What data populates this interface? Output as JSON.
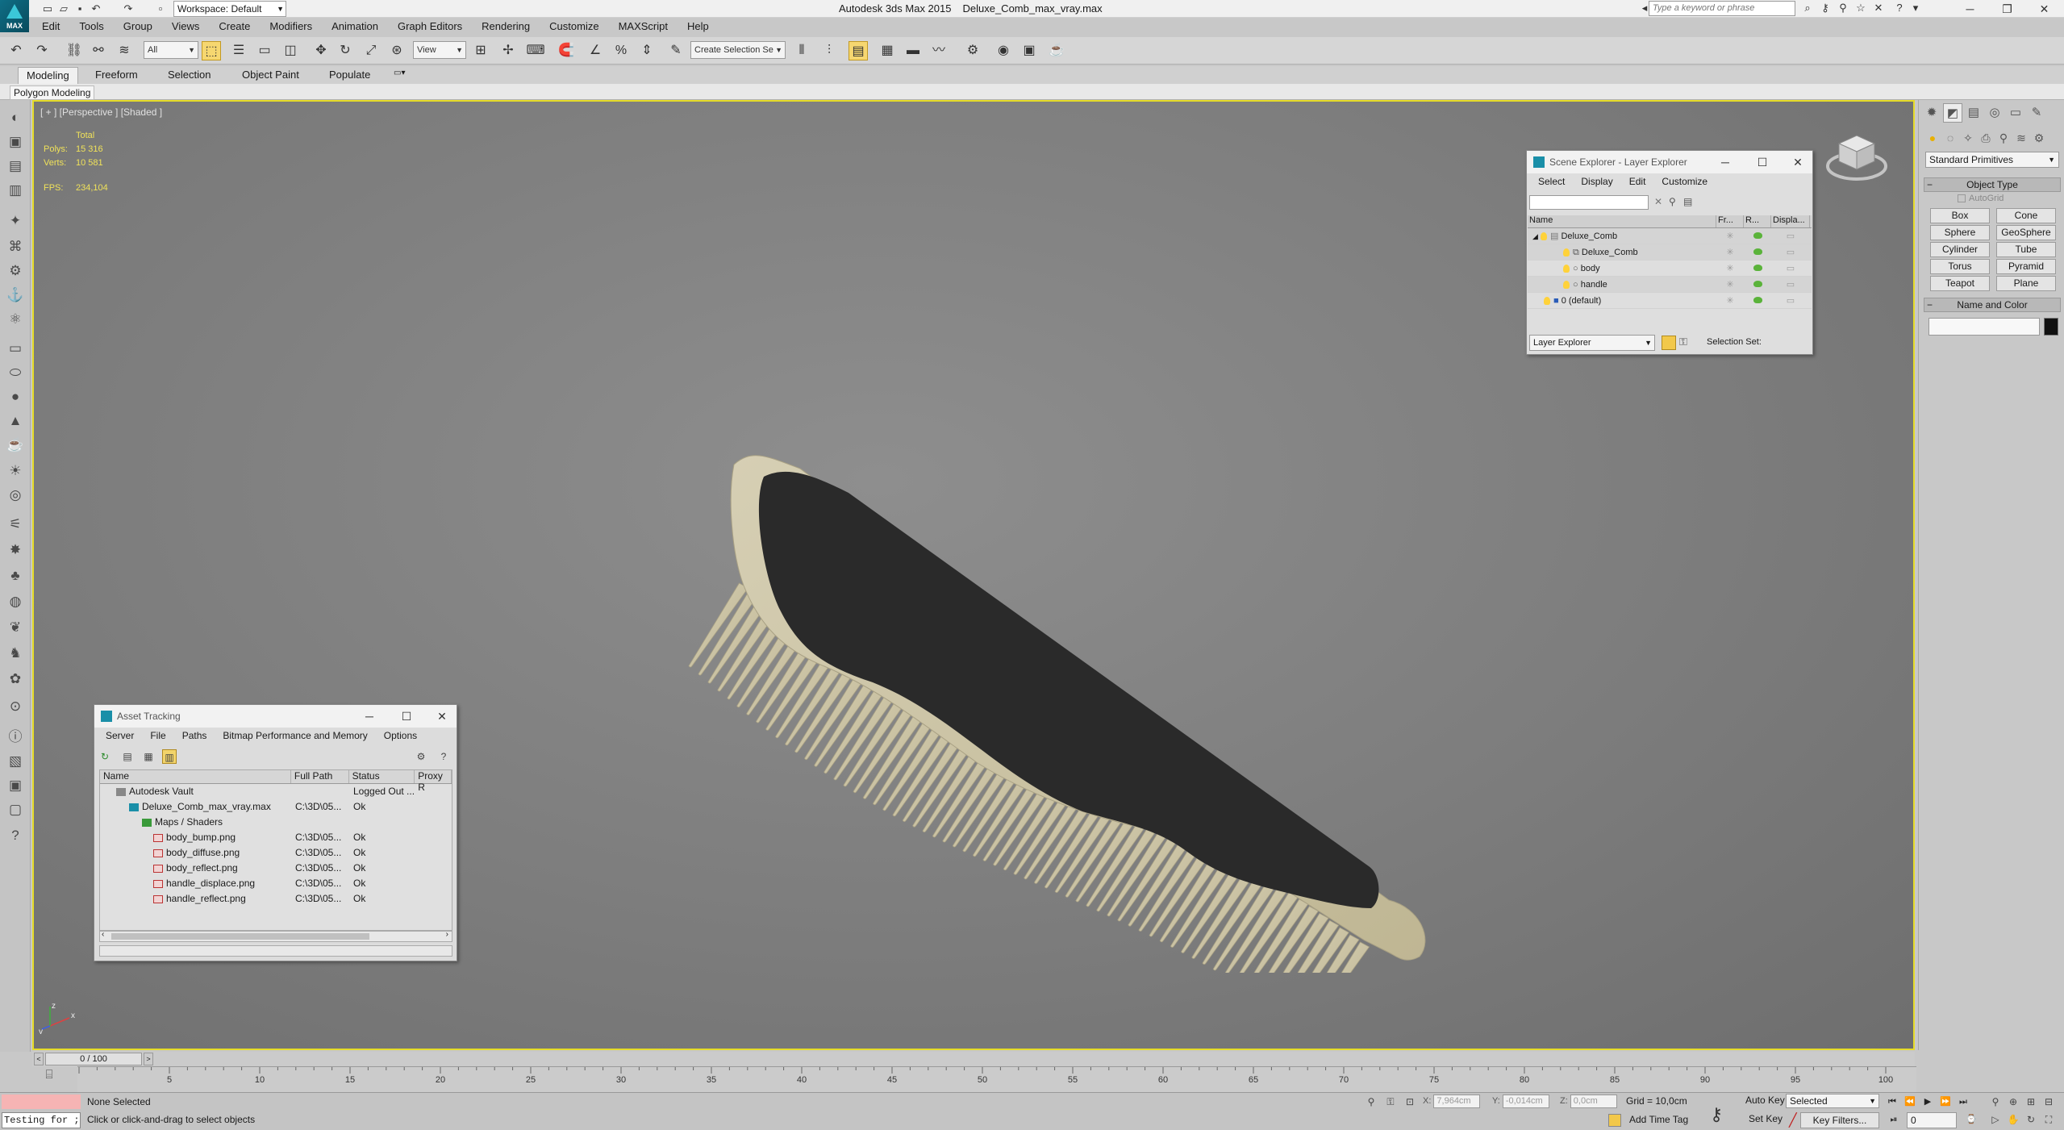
{
  "app": {
    "logo_text": "MAX",
    "title": "Autodesk 3ds Max  2015",
    "filename": "Deluxe_Comb_max_vray.max",
    "workspace": "Workspace: Default",
    "search_placeholder": "Type a keyword or phrase"
  },
  "menus": [
    "Edit",
    "Tools",
    "Group",
    "Views",
    "Create",
    "Modifiers",
    "Animation",
    "Graph Editors",
    "Rendering",
    "Customize",
    "MAXScript",
    "Help"
  ],
  "toolbar": {
    "filter": "All",
    "ref_coord": "View",
    "named_selection": "Create Selection Se"
  },
  "ribbon": {
    "tabs": [
      "Modeling",
      "Freeform",
      "Selection",
      "Object Paint",
      "Populate"
    ],
    "active_tab": "Modeling",
    "panel_label": "Polygon Modeling"
  },
  "viewport": {
    "label": "[ + ] [Perspective ] [Shaded ]",
    "stats_header": "Total",
    "polys_label": "Polys:",
    "polys": "15 316",
    "verts_label": "Verts:",
    "verts": "10 581",
    "fps_label": "FPS:",
    "fps": "234,104",
    "border_color": "#e6dc28",
    "axis_x": "x",
    "axis_y": "y",
    "axis_z": "z"
  },
  "scene_explorer": {
    "title": "Scene Explorer - Layer Explorer",
    "menu": [
      "Select",
      "Display",
      "Edit",
      "Customize"
    ],
    "columns": [
      "Name",
      "Fr...",
      "R...",
      "Displa..."
    ],
    "rows": [
      {
        "name": "Deluxe_Comb"
      },
      {
        "name": "Deluxe_Comb"
      },
      {
        "name": "body"
      },
      {
        "name": "handle"
      },
      {
        "name": "0 (default)"
      }
    ],
    "explorer_type": "Layer Explorer",
    "selection_set_label": "Selection Set:"
  },
  "command_panel": {
    "category": "Standard Primitives",
    "object_type_title": "Object Type",
    "autogrid": "AutoGrid",
    "buttons": [
      "Box",
      "Cone",
      "Sphere",
      "GeoSphere",
      "Cylinder",
      "Tube",
      "Torus",
      "Pyramid",
      "Teapot",
      "Plane"
    ],
    "name_color_title": "Name and Color"
  },
  "asset_tracking": {
    "title": "Asset Tracking",
    "menu": [
      "Server",
      "File",
      "Paths",
      "Bitmap Performance and Memory",
      "Options"
    ],
    "columns": [
      "Name",
      "Full Path",
      "Status",
      "Proxy R"
    ],
    "rows": [
      {
        "name": "Autodesk Vault",
        "path": "",
        "status": "Logged Out ..."
      },
      {
        "name": "Deluxe_Comb_max_vray.max",
        "path": "C:\\3D\\05...",
        "status": "Ok"
      },
      {
        "name": "Maps / Shaders",
        "path": "",
        "status": ""
      },
      {
        "name": "body_bump.png",
        "path": "C:\\3D\\05...",
        "status": "Ok"
      },
      {
        "name": "body_diffuse.png",
        "path": "C:\\3D\\05...",
        "status": "Ok"
      },
      {
        "name": "body_reflect.png",
        "path": "C:\\3D\\05...",
        "status": "Ok"
      },
      {
        "name": "handle_displace.png",
        "path": "C:\\3D\\05...",
        "status": "Ok"
      },
      {
        "name": "handle_reflect.png",
        "path": "C:\\3D\\05...",
        "status": "Ok"
      }
    ]
  },
  "timeline": {
    "frame_display": "0 / 100",
    "ticks": [
      "5",
      "10",
      "15",
      "20",
      "25",
      "30",
      "35",
      "40",
      "45",
      "50",
      "55",
      "60",
      "65",
      "70",
      "75",
      "80",
      "85",
      "90",
      "95",
      "100"
    ]
  },
  "status": {
    "maxscript_text": "Testing for ;",
    "selection": "None Selected",
    "prompt": "Click or click-and-drag to select objects",
    "x_label": "X:",
    "x_value": "7,964cm",
    "y_label": "Y:",
    "y_value": "-0,014cm",
    "z_label": "Z:",
    "z_value": "0,0cm",
    "grid": "Grid = 10,0cm",
    "add_time_tag": "Add Time Tag",
    "auto_key": "Auto Key",
    "set_key": "Set Key",
    "key_mode": "Selected",
    "key_filters": "Key Filters...",
    "current_frame": "0"
  }
}
